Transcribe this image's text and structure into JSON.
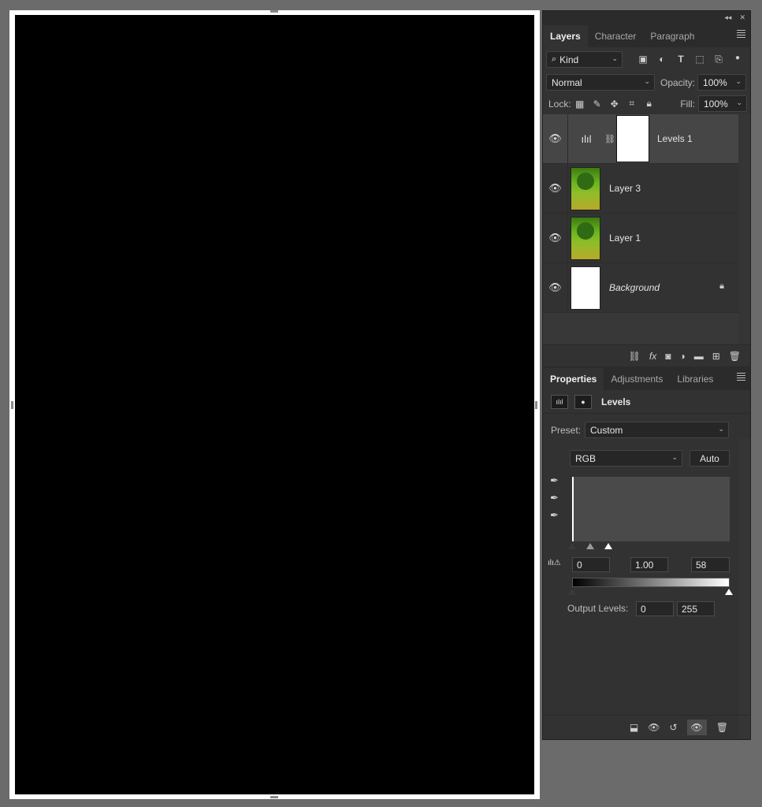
{
  "panel_controls": {
    "collapse": "◂◂",
    "close": "✕"
  },
  "layers_panel": {
    "tabs": [
      {
        "label": "Layers",
        "active": true
      },
      {
        "label": "Character",
        "active": false
      },
      {
        "label": "Paragraph",
        "active": false
      }
    ],
    "filter": {
      "kind_label": "Kind"
    },
    "blend_mode": "Normal",
    "opacity_label": "Opacity:",
    "opacity_value": "100%",
    "lock_label": "Lock:",
    "fill_label": "Fill:",
    "fill_value": "100%",
    "layers": [
      {
        "name": "Levels 1",
        "type": "adjustment",
        "selected": true,
        "visible": true
      },
      {
        "name": "Layer 3",
        "type": "photo",
        "selected": false,
        "visible": true
      },
      {
        "name": "Layer 1",
        "type": "photo",
        "selected": false,
        "visible": true
      },
      {
        "name": "Background",
        "type": "white",
        "selected": false,
        "visible": true,
        "locked": true
      }
    ]
  },
  "properties_panel": {
    "tabs": [
      {
        "label": "Properties",
        "active": true
      },
      {
        "label": "Adjustments",
        "active": false
      },
      {
        "label": "Libraries",
        "active": false
      }
    ],
    "title": "Levels",
    "preset_label": "Preset:",
    "preset_value": "Custom",
    "channel_value": "RGB",
    "auto_label": "Auto",
    "input_black": "0",
    "input_gamma": "1.00",
    "input_white": "58",
    "output_label": "Output Levels:",
    "output_black": "0",
    "output_white": "255"
  }
}
